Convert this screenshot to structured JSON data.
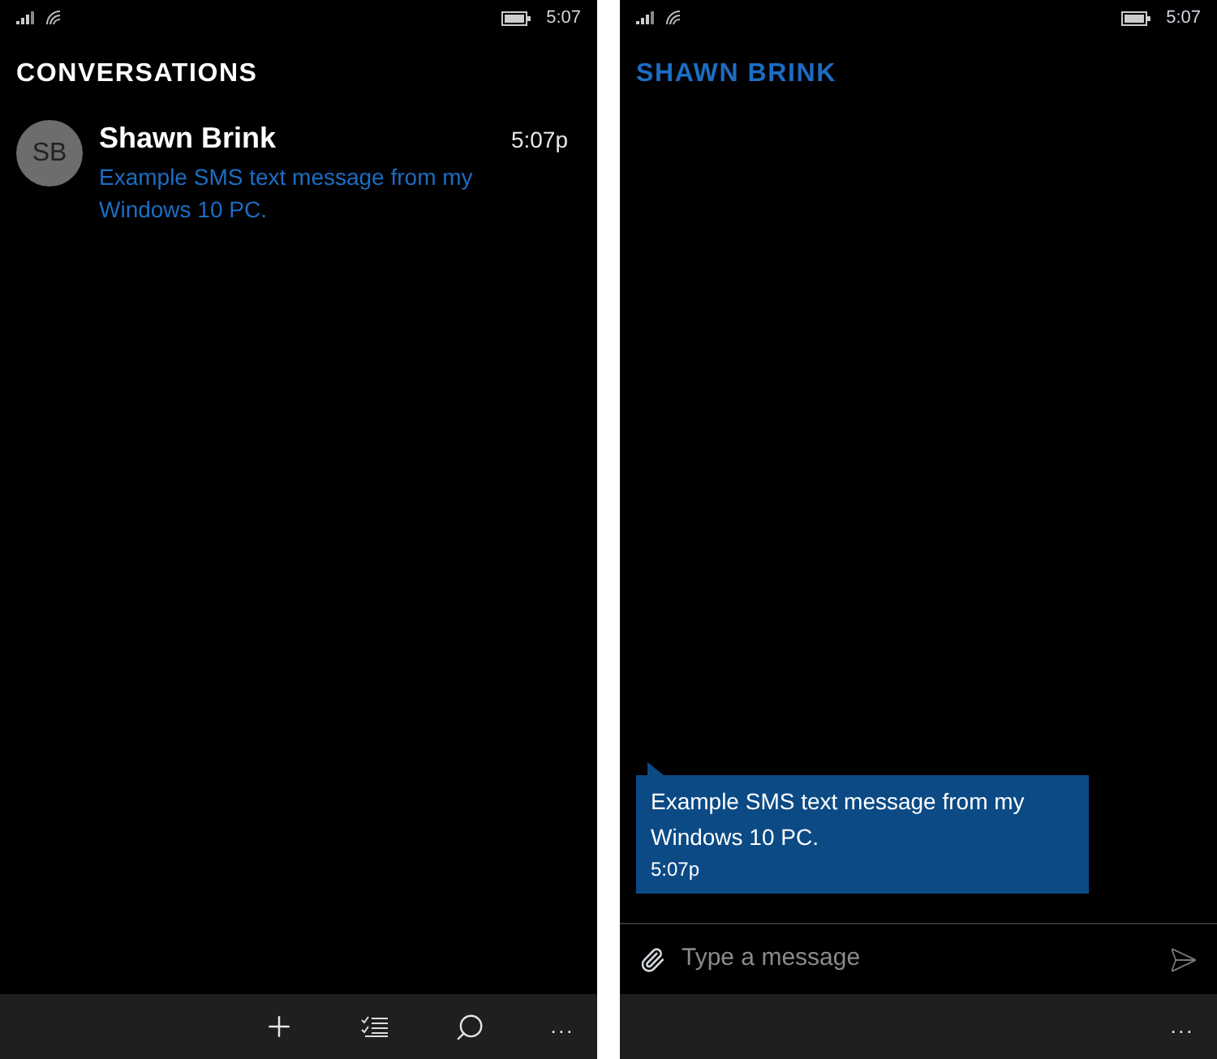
{
  "screens": [
    {
      "kind": "list",
      "status_bar": {
        "time": "5:07"
      },
      "title": "CONVERSATIONS",
      "conversations": [
        {
          "initials": "SB",
          "name": "Shawn Brink",
          "time": "5:07p",
          "preview": "Example SMS text message from my Windows 10 PC."
        }
      ],
      "app_bar": {
        "more": "..."
      }
    },
    {
      "kind": "thread",
      "status_bar": {
        "time": "5:07"
      },
      "title": "SHAWN BRINK",
      "messages": [
        {
          "text": "Example SMS text message from my Windows 10 PC.",
          "time": "5:07p"
        }
      ],
      "composer": {
        "placeholder": "Type a message"
      },
      "app_bar": {
        "more": "..."
      }
    }
  ]
}
